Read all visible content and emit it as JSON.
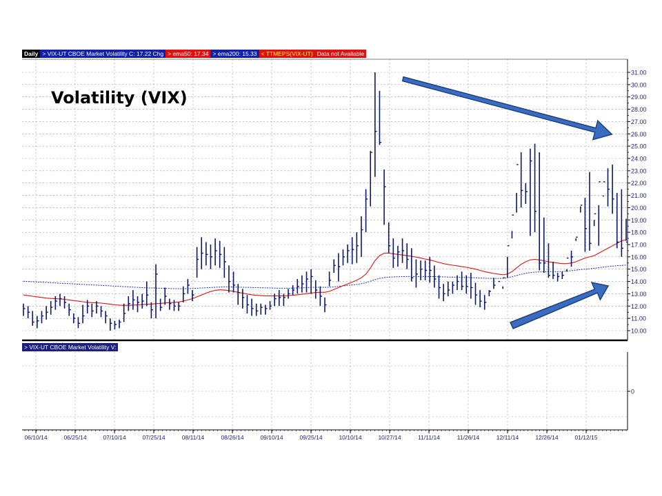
{
  "legend": {
    "daily": "Daily",
    "symbol": "> VIX-UT  CBOE Market Volatility  C: 17.22  Chg",
    "ema50": "> ema50: 17.34",
    "ema200": "> ema200: 15.33",
    "ttmeps": "< TTMEPS(VIX-UT)",
    "not_available": "Data not Available"
  },
  "lower_legend": "> VIX-UT  CBOE Market Volatility  V:",
  "title": "Volatility (VIX)",
  "colors": {
    "bars": "#0a1570",
    "ema50": "#e01010",
    "ema200": "#1030c8",
    "arrow": "#3a6cc0",
    "arrow_stroke": "#1e3f80"
  },
  "chart_data": {
    "type": "ohlc",
    "title": "Volatility (VIX)",
    "y_ticks": [
      "10.00",
      "11.00",
      "12.00",
      "13.00",
      "14.00",
      "15.00",
      "16.00",
      "17.00",
      "18.00",
      "19.00",
      "20.00",
      "21.00",
      "22.00",
      "23.00",
      "24.00",
      "25.00",
      "26.00",
      "27.00",
      "28.00",
      "29.00",
      "30.00",
      "31.00"
    ],
    "ylim": [
      9.3,
      31.9
    ],
    "x_ticks": [
      "06/10/14",
      "06/25/14",
      "07/10/14",
      "07/25/14",
      "08/11/14",
      "08/26/14",
      "09/10/14",
      "09/25/14",
      "10/10/14",
      "10/27/14",
      "11/11/14",
      "11/26/14",
      "12/11/14",
      "12/26/14",
      "01/12/15"
    ],
    "lower_axis_tick": "0",
    "series": [
      {
        "name": "VIX-UT",
        "high": [
          12.2,
          12.0,
          11.6,
          11.2,
          11.6,
          12.0,
          12.4,
          12.8,
          13.0,
          12.8,
          12.2,
          11.4,
          11.1,
          12.1,
          12.5,
          12.2,
          12.4,
          12.0,
          11.6,
          11.0,
          10.8,
          10.9,
          12.2,
          12.8,
          13.3,
          12.8,
          13.0,
          14.0,
          12.3,
          15.4,
          12.6,
          13.5,
          12.6,
          12.5,
          12.3,
          13.6,
          14.2,
          13.3,
          16.8,
          17.6,
          17.2,
          17.0,
          17.5,
          17.3,
          16.8,
          15.3,
          14.8,
          13.8,
          13.4,
          12.9,
          12.6,
          12.2,
          12.2,
          12.1,
          12.4,
          13.0,
          13.3,
          13.0,
          13.4,
          13.7,
          14.2,
          14.5,
          14.8,
          15.0,
          14.1,
          13.6,
          12.7,
          14.8,
          15.8,
          16.3,
          16.6,
          17.0,
          17.6,
          18.0,
          19.3,
          21.5,
          24.6,
          31.0,
          29.5,
          23.1,
          18.8,
          17.5,
          16.9,
          17.5,
          17.1,
          16.7,
          15.8,
          15.7,
          15.7,
          16.0,
          15.3,
          14.5,
          13.8,
          14.0,
          14.0,
          14.5,
          14.8,
          14.5,
          14.7,
          13.9,
          13.3,
          12.9,
          13.3,
          14.3,
          14.0,
          13.6,
          14.3,
          17.5,
          19.6,
          24.5,
          22.0,
          24.8,
          25.2,
          24.5,
          19.2,
          17.1,
          15.6,
          14.7,
          14.8,
          14.8,
          16.5,
          17.5,
          20.1,
          20.8,
          22.9,
          19.0,
          16.9,
          20.9,
          23.2,
          23.5,
          21.2,
          21.5,
          19.1,
          18.4,
          17.2,
          18.4
        ],
        "low": [
          11.2,
          11.0,
          10.4,
          10.2,
          10.6,
          10.9,
          11.3,
          11.7,
          12.0,
          11.8,
          11.2,
          10.6,
          10.2,
          10.6,
          11.4,
          11.1,
          11.4,
          11.1,
          10.6,
          10.0,
          10.1,
          10.2,
          10.7,
          11.6,
          11.7,
          11.5,
          11.8,
          12.0,
          11.0,
          11.0,
          11.6,
          12.1,
          11.7,
          11.6,
          11.6,
          12.3,
          13.0,
          12.4,
          14.3,
          15.0,
          15.3,
          15.0,
          15.3,
          15.1,
          14.3,
          13.1,
          13.1,
          12.1,
          11.8,
          11.4,
          11.2,
          11.2,
          11.3,
          11.3,
          11.7,
          12.0,
          12.0,
          12.0,
          12.6,
          12.9,
          13.0,
          13.1,
          13.1,
          13.0,
          12.6,
          12.0,
          11.5,
          13.6,
          14.7,
          14.0,
          15.3,
          15.5,
          15.4,
          15.5,
          16.0,
          18.0,
          20.1,
          22.5,
          25.1,
          18.6,
          16.3,
          15.1,
          15.2,
          15.5,
          15.0,
          14.0,
          13.5,
          14.1,
          14.1,
          13.9,
          13.5,
          12.6,
          12.4,
          12.8,
          13.0,
          13.3,
          13.3,
          13.0,
          12.6,
          12.1,
          11.9,
          11.7,
          12.8,
          13.4,
          14.0,
          13.4,
          16.0,
          18.1,
          21.2,
          20.0,
          20.3,
          17.7,
          18.0,
          14.9,
          14.7,
          14.3,
          14.2,
          14.0,
          14.2,
          15.0,
          15.2,
          17.3,
          19.6,
          16.4,
          16.5,
          18.5,
          20.2,
          21.0,
          20.1,
          19.5,
          16.7,
          16.0,
          17.3
        ],
        "close": [
          11.8,
          11.5,
          10.7,
          10.8,
          11.2,
          11.5,
          11.9,
          12.4,
          12.6,
          12.3,
          11.7,
          11.0,
          10.6,
          11.2,
          12.0,
          11.6,
          12.0,
          11.6,
          11.2,
          10.6,
          10.5,
          10.7,
          11.4,
          12.2,
          12.5,
          12.3,
          12.4,
          12.9,
          11.7,
          14.6,
          11.9,
          12.8,
          12.2,
          12.0,
          12.0,
          13.0,
          13.7,
          12.9,
          15.8,
          16.3,
          16.2,
          16.0,
          16.5,
          16.2,
          15.6,
          14.0,
          13.7,
          13.1,
          12.7,
          12.1,
          11.8,
          11.6,
          11.9,
          11.8,
          12.0,
          12.6,
          12.7,
          12.7,
          13.0,
          13.3,
          13.6,
          13.8,
          14.2,
          14.4,
          13.3,
          12.8,
          12.1,
          14.1,
          15.3,
          15.2,
          16.0,
          16.5,
          16.6,
          16.9,
          18.2,
          20.7,
          24.5,
          26.2,
          25.3,
          21.7,
          16.9,
          15.9,
          16.4,
          16.5,
          15.8,
          14.3,
          14.6,
          15.0,
          14.9,
          14.9,
          14.2,
          13.5,
          13.0,
          13.3,
          13.7,
          14.0,
          13.6,
          13.6,
          13.5,
          12.9,
          12.4,
          12.3,
          13.2,
          13.7,
          14.0,
          14.3,
          16.9,
          19.4,
          23.5,
          21.4,
          21.3,
          23.8,
          19.7,
          15.5,
          15.5,
          14.5,
          14.5,
          14.4,
          14.5,
          15.9,
          16.0,
          17.6,
          20.2,
          18.3,
          17.1,
          19.5,
          22.1,
          22.1,
          21.5,
          20.7,
          17.2,
          16.7,
          17.2
        ]
      }
    ],
    "ema50": [
      12.9,
      12.85,
      12.8,
      12.75,
      12.7,
      12.65,
      12.62,
      12.6,
      12.58,
      12.55,
      12.5,
      12.45,
      12.4,
      12.35,
      12.3,
      12.28,
      12.26,
      12.24,
      12.2,
      12.15,
      12.1,
      12.08,
      12.06,
      12.06,
      12.08,
      12.1,
      12.12,
      12.14,
      12.16,
      12.2,
      12.22,
      12.25,
      12.28,
      12.3,
      12.33,
      12.4,
      12.5,
      12.6,
      12.75,
      12.9,
      13.05,
      13.18,
      13.28,
      13.32,
      13.3,
      13.26,
      13.2,
      13.12,
      13.05,
      12.98,
      12.92,
      12.88,
      12.85,
      12.83,
      12.82,
      12.82,
      12.82,
      12.83,
      12.85,
      12.88,
      12.92,
      12.96,
      13.0,
      13.06,
      13.1,
      13.12,
      13.12,
      13.2,
      13.35,
      13.5,
      13.65,
      13.8,
      13.95,
      14.1,
      14.3,
      14.6,
      15.1,
      15.7,
      16.1,
      16.3,
      16.3,
      16.25,
      16.2,
      16.15,
      16.1,
      16.05,
      15.98,
      15.9,
      15.82,
      15.75,
      15.65,
      15.55,
      15.45,
      15.38,
      15.32,
      15.27,
      15.2,
      15.15,
      15.08,
      15.0,
      14.9,
      14.8,
      14.72,
      14.65,
      14.6,
      14.55,
      14.6,
      14.8,
      15.1,
      15.4,
      15.6,
      15.75,
      15.8,
      15.75,
      15.68,
      15.6,
      15.55,
      15.5,
      15.45,
      15.45,
      15.5,
      15.6,
      15.75,
      15.9,
      16.0,
      16.1,
      16.3,
      16.5,
      16.7,
      16.9,
      17.1,
      17.3,
      17.4
    ],
    "ema200": [
      14.02,
      14.0,
      13.98,
      13.96,
      13.94,
      13.92,
      13.9,
      13.88,
      13.86,
      13.84,
      13.82,
      13.8,
      13.78,
      13.76,
      13.74,
      13.72,
      13.7,
      13.68,
      13.66,
      13.64,
      13.62,
      13.6,
      13.58,
      13.56,
      13.54,
      13.52,
      13.5,
      13.48,
      13.47,
      13.46,
      13.45,
      13.44,
      13.43,
      13.42,
      13.41,
      13.41,
      13.42,
      13.43,
      13.45,
      13.47,
      13.49,
      13.51,
      13.53,
      13.55,
      13.56,
      13.56,
      13.55,
      13.54,
      13.53,
      13.52,
      13.51,
      13.5,
      13.49,
      13.48,
      13.47,
      13.46,
      13.45,
      13.45,
      13.45,
      13.46,
      13.47,
      13.48,
      13.5,
      13.52,
      13.53,
      13.53,
      13.52,
      13.53,
      13.56,
      13.6,
      13.64,
      13.68,
      13.72,
      13.76,
      13.82,
      13.9,
      14.02,
      14.15,
      14.25,
      14.32,
      14.35,
      14.37,
      14.38,
      14.39,
      14.4,
      14.4,
      14.4,
      14.4,
      14.4,
      14.4,
      14.39,
      14.38,
      14.37,
      14.36,
      14.35,
      14.34,
      14.33,
      14.32,
      14.31,
      14.3,
      14.28,
      14.26,
      14.25,
      14.25,
      14.25,
      14.25,
      14.3,
      14.38,
      14.48,
      14.58,
      14.66,
      14.72,
      14.76,
      14.78,
      14.79,
      14.8,
      14.8,
      14.8,
      14.81,
      14.84,
      14.88,
      14.92,
      14.97,
      15.0,
      15.03,
      15.07,
      15.12,
      15.17,
      15.21,
      15.25,
      15.28,
      15.31,
      15.33
    ]
  }
}
